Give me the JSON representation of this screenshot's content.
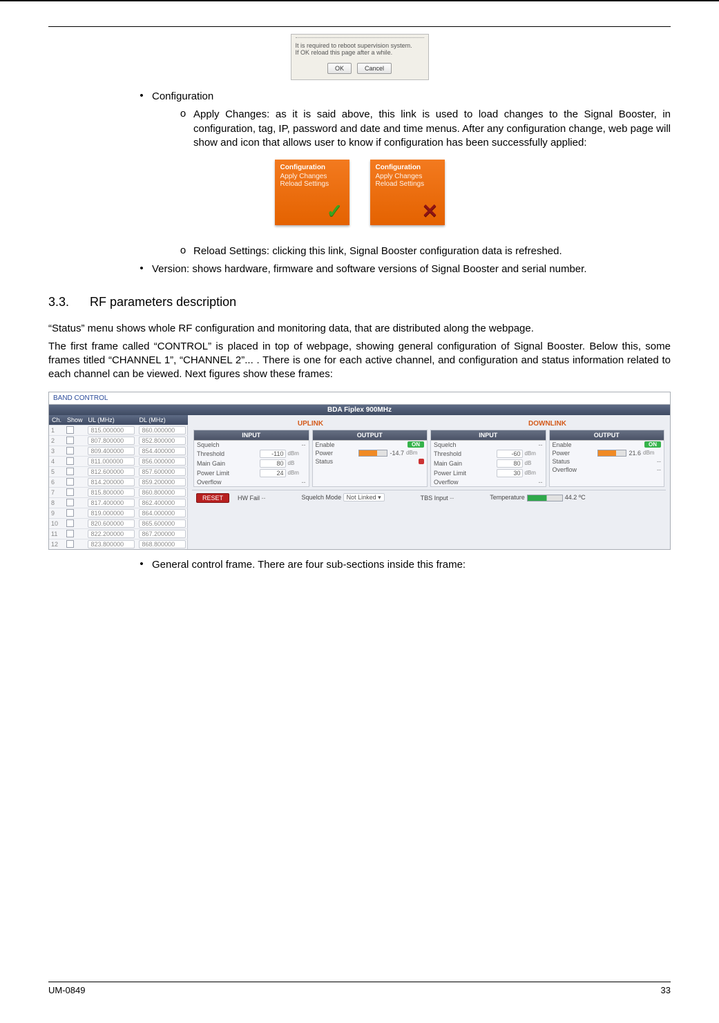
{
  "dialog": {
    "line1": "It is required to reboot supervision system.",
    "line2": "If OK reload this page after a while.",
    "ok": "OK",
    "cancel": "Cancel"
  },
  "b_configuration": "Configuration",
  "b_apply_changes_label": "Apply Changes:",
  "b_apply_changes_text": "as it is said above, this link is used to load changes to the Signal Booster, in configuration, tag, IP, password and date and time menus. After any configuration change, web page will show and icon that allows user to know if configuration has been successfully applied:",
  "card": {
    "t1": "Configuration",
    "t2": "Apply Changes",
    "t3": "Reload Settings"
  },
  "b_reload_label": "Reload Settings:",
  "b_reload_text": "clicking this link, Signal Booster configuration data is refreshed.",
  "b_version_label": "Version:",
  "b_version_text": "shows hardware, firmware and software versions of Signal Booster and serial number.",
  "section_num": "3.3.",
  "section_title": "RF parameters description",
  "para1": "“Status” menu shows whole RF configuration and monitoring data, that are distributed along the webpage.",
  "para2": "The first frame called “CONTROL” is placed in top of webpage, showing general configuration of Signal Booster. Below this, some frames titled “CHANNEL 1”, “CHANNEL 2”...  . There is one for each active channel, and configuration and status information related to each channel can be viewed. Next figures show these frames:",
  "panel": {
    "band_control": "BAND CONTROL",
    "header": "BDA Fiplex 900MHz",
    "cols": {
      "ch": "Ch.",
      "show": "Show",
      "ul": "UL (MHz)",
      "dl": "DL (MHz)"
    },
    "rows": [
      {
        "ch": "1",
        "ul": "815.000000",
        "dl": "860.000000"
      },
      {
        "ch": "2",
        "ul": "807.800000",
        "dl": "852.800000"
      },
      {
        "ch": "3",
        "ul": "809.400000",
        "dl": "854.400000"
      },
      {
        "ch": "4",
        "ul": "811.000000",
        "dl": "856.000000"
      },
      {
        "ch": "5",
        "ul": "812.600000",
        "dl": "857.600000"
      },
      {
        "ch": "6",
        "ul": "814.200000",
        "dl": "859.200000"
      },
      {
        "ch": "7",
        "ul": "815.800000",
        "dl": "860.800000"
      },
      {
        "ch": "8",
        "ul": "817.400000",
        "dl": "862.400000"
      },
      {
        "ch": "9",
        "ul": "819.000000",
        "dl": "864.000000"
      },
      {
        "ch": "10",
        "ul": "820.600000",
        "dl": "865.600000"
      },
      {
        "ch": "11",
        "ul": "822.200000",
        "dl": "867.200000"
      },
      {
        "ch": "12",
        "ul": "823.800000",
        "dl": "868.800000"
      }
    ],
    "uplink": "UPLINK",
    "downlink": "DOWNLINK",
    "input": "INPUT",
    "output": "OUTPUT",
    "squelch": "Squelch",
    "threshold": "Threshold",
    "th_ul": "-110",
    "th_dl": "-60",
    "main_gain": "Main Gain",
    "mg_ul": "80",
    "mg_dl": "80",
    "power_limit": "Power Limit",
    "pl_ul": "24",
    "pl_dl": "30",
    "overflow": "Overflow",
    "enable": "Enable",
    "on": "ON",
    "power": "Power",
    "pw_ul": "-14.7",
    "pw_dl": "21.6",
    "status": "Status",
    "dbm": "dBm",
    "db": "dB",
    "reset": "RESET",
    "hw_fail": "HW Fail",
    "squelch_mode": "Squelch Mode",
    "not_linked": "Not Linked",
    "tbs_input": "TBS Input",
    "temperature": "Temperature",
    "temp_val": "44.2",
    "temp_unit": "ºC",
    "dash": "--"
  },
  "b_general": "General control frame. There are four sub-sections inside this frame:",
  "footer_left": "UM-0849",
  "footer_right": "33"
}
